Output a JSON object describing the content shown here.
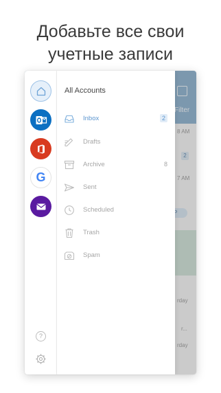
{
  "headline": {
    "line1": "Добавьте все свои",
    "line2": "учетные записи"
  },
  "background_app": {
    "filter_label": "Filter",
    "badge_count": "2",
    "pill_label": "P",
    "fragments": [
      "8 AM",
      "7 AM",
      "rday",
      "r...",
      "rday"
    ]
  },
  "rail": {
    "accounts": [
      {
        "name": "home-icon"
      },
      {
        "name": "outlook-icon",
        "color": "#0b6fc2"
      },
      {
        "name": "office-icon",
        "color": "#d83b20"
      },
      {
        "name": "google-icon",
        "letter": "G"
      },
      {
        "name": "mail-icon",
        "color": "#5a1aa0"
      }
    ],
    "help_symbol": "?"
  },
  "drawer": {
    "title": "All Accounts",
    "folders": [
      {
        "label": "Inbox",
        "count": "2",
        "icon": "inbox-icon",
        "active": true
      },
      {
        "label": "Drafts",
        "count": "",
        "icon": "drafts-icon",
        "active": false
      },
      {
        "label": "Archive",
        "count": "8",
        "icon": "archive-icon",
        "active": false
      },
      {
        "label": "Sent",
        "count": "",
        "icon": "sent-icon",
        "active": false
      },
      {
        "label": "Scheduled",
        "count": "",
        "icon": "scheduled-icon",
        "active": false
      },
      {
        "label": "Trash",
        "count": "",
        "icon": "trash-icon",
        "active": false
      },
      {
        "label": "Spam",
        "count": "",
        "icon": "spam-icon",
        "active": false
      }
    ]
  },
  "colors": {
    "accent": "#5b95cf",
    "header_blue": "#8fb2cf",
    "muted": "#a6a6a6"
  }
}
